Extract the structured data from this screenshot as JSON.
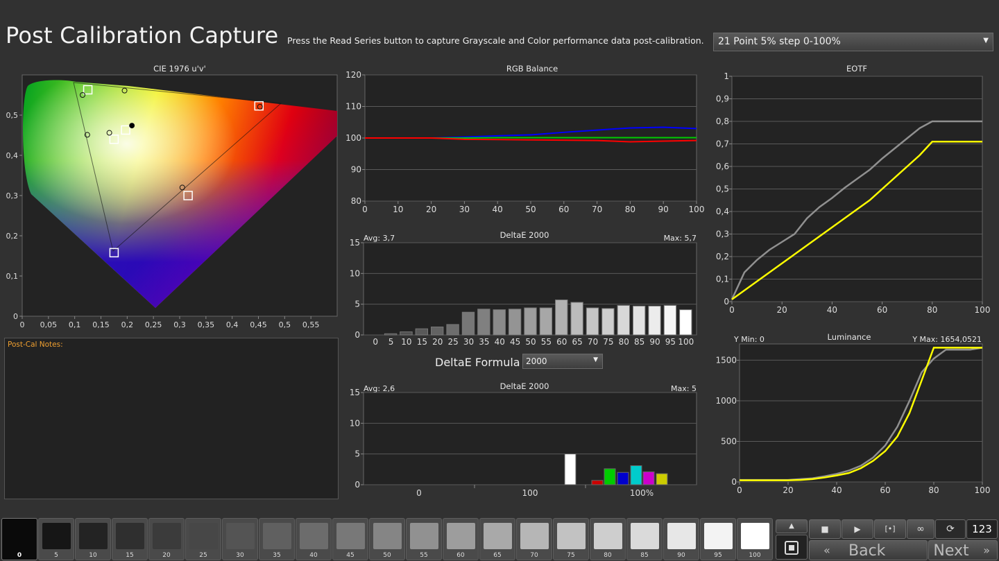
{
  "header": {
    "title": "Post Calibration Capture",
    "instruction": "Press the Read Series button to capture Grayscale and Color performance data post-calibration.",
    "series_option": "21 Point 5% step 0-100%"
  },
  "cie": {
    "title": "CIE 1976 u'v'",
    "x_ticks": [
      "0",
      "0,05",
      "0,1",
      "0,15",
      "0,2",
      "0,25",
      "0,3",
      "0,35",
      "0,4",
      "0,45",
      "0,5",
      "0,55"
    ],
    "y_ticks": [
      "0",
      "0,1",
      "0,2",
      "0,3",
      "0,4",
      "0,5"
    ],
    "targets": [
      [
        0.451,
        0.523
      ],
      [
        0.125,
        0.563
      ],
      [
        0.175,
        0.158
      ],
      [
        0.175,
        0.44
      ],
      [
        0.316,
        0.3
      ],
      [
        0.197,
        0.463
      ]
    ],
    "measured": [
      [
        0.453,
        0.521
      ],
      [
        0.115,
        0.55
      ],
      [
        0.124,
        0.451
      ],
      [
        0.166,
        0.456
      ],
      [
        0.195,
        0.561
      ],
      [
        0.305,
        0.32
      ],
      [
        0.209,
        0.474
      ]
    ]
  },
  "notes": {
    "label": "Post-Cal Notes:",
    "text": ""
  },
  "rgb_balance": {
    "title": "RGB Balance",
    "y_ticks": [
      "80",
      "90",
      "100",
      "110",
      "120"
    ],
    "x_ticks": [
      "0",
      "10",
      "20",
      "30",
      "40",
      "50",
      "60",
      "70",
      "80",
      "90",
      "100"
    ]
  },
  "deltae_gray": {
    "avg": "Avg: 3,7",
    "title": "DeltaE 2000",
    "max": "Max: 5,7",
    "y_ticks": [
      "0",
      "5",
      "10",
      "15"
    ],
    "x_labels": [
      "0",
      "5",
      "10",
      "15",
      "20",
      "25",
      "30",
      "35",
      "40",
      "45",
      "50",
      "55",
      "60",
      "65",
      "70",
      "75",
      "80",
      "85",
      "90",
      "95",
      "100"
    ]
  },
  "formula": {
    "label": "DeltaE Formula",
    "value": "2000"
  },
  "deltae_color": {
    "avg": "Avg: 2,6",
    "title": "DeltaE 2000",
    "max": "Max: 5",
    "y_ticks": [
      "0",
      "5",
      "10",
      "15"
    ],
    "x_labels": [
      "0",
      "100",
      "100%"
    ]
  },
  "eotf": {
    "title": "EOTF",
    "y_ticks": [
      "0",
      "0,1",
      "0,2",
      "0,3",
      "0,4",
      "0,5",
      "0,6",
      "0,7",
      "0,8",
      "0,9",
      "1"
    ],
    "x_ticks": [
      "0",
      "20",
      "40",
      "60",
      "80",
      "100"
    ]
  },
  "luminance": {
    "title": "Luminance",
    "ymin": "Y Min: 0",
    "ymax": "Y Max: 1654,0521",
    "y_ticks": [
      "0",
      "500",
      "1000",
      "1500"
    ],
    "x_ticks": [
      "0",
      "20",
      "40",
      "60",
      "80",
      "100"
    ]
  },
  "swatches": [
    "0",
    "5",
    "10",
    "15",
    "20",
    "25",
    "30",
    "35",
    "40",
    "45",
    "50",
    "55",
    "60",
    "65",
    "70",
    "75",
    "80",
    "85",
    "90",
    "95",
    "100"
  ],
  "controls": {
    "back": "Back",
    "next": "Next",
    "counter": "123"
  },
  "chart_data": [
    {
      "type": "line",
      "title": "RGB Balance",
      "x": [
        0,
        10,
        20,
        30,
        40,
        50,
        60,
        70,
        80,
        90,
        100
      ],
      "ylim": [
        80,
        120
      ],
      "series": [
        {
          "color": "#0000ff",
          "values": [
            100,
            100,
            100,
            100.3,
            100.7,
            101,
            101.8,
            102.5,
            103.2,
            103.4,
            103
          ]
        },
        {
          "color": "#00cc00",
          "values": [
            100,
            100,
            100,
            100,
            100.1,
            100.1,
            100.1,
            100.1,
            100.1,
            100.1,
            100.1
          ]
        },
        {
          "color": "#ff0000",
          "values": [
            100,
            100,
            100,
            99.6,
            99.5,
            99.4,
            99.3,
            99.2,
            98.8,
            99,
            99.2
          ]
        }
      ]
    },
    {
      "type": "bar",
      "title": "DeltaE 2000",
      "categories": [
        "0",
        "5",
        "10",
        "15",
        "20",
        "25",
        "30",
        "35",
        "40",
        "45",
        "50",
        "55",
        "60",
        "65",
        "70",
        "75",
        "80",
        "85",
        "90",
        "95",
        "100"
      ],
      "values": [
        0,
        0.2,
        0.5,
        1,
        1.3,
        1.7,
        3.7,
        4.2,
        4.1,
        4.2,
        4.4,
        4.4,
        5.7,
        5.3,
        4.4,
        4.3,
        4.8,
        4.7,
        4.7,
        4.8,
        4.1
      ],
      "ylim": [
        0,
        15
      ]
    },
    {
      "type": "bar",
      "title": "DeltaE 2000",
      "categories": [
        "W",
        "R",
        "G",
        "B",
        "C",
        "M",
        "Y"
      ],
      "values": [
        5,
        0.7,
        2.6,
        2,
        3.1,
        2.1,
        1.8
      ],
      "colors": [
        "#ffffff",
        "#cc0000",
        "#00cc00",
        "#0000cc",
        "#00cccc",
        "#cc00cc",
        "#cccc00"
      ],
      "ylim": [
        0,
        15
      ]
    },
    {
      "type": "line",
      "title": "EOTF",
      "x": [
        0,
        5,
        10,
        15,
        20,
        25,
        30,
        35,
        40,
        45,
        50,
        55,
        60,
        65,
        70,
        75,
        80,
        85,
        90,
        95,
        100
      ],
      "xlim": [
        0,
        100
      ],
      "ylim": [
        0,
        1
      ],
      "series": [
        {
          "color": "#909090",
          "values": [
            0.01,
            0.13,
            0.185,
            0.23,
            0.265,
            0.3,
            0.37,
            0.42,
            0.46,
            0.505,
            0.545,
            0.585,
            0.635,
            0.68,
            0.725,
            0.77,
            0.8,
            0.8,
            0.8,
            0.8,
            0.8
          ]
        },
        {
          "color": "#ffff00",
          "values": [
            0.01,
            0.05,
            0.09,
            0.13,
            0.17,
            0.21,
            0.25,
            0.29,
            0.33,
            0.37,
            0.41,
            0.45,
            0.5,
            0.55,
            0.6,
            0.65,
            0.71,
            0.71,
            0.71,
            0.71,
            0.71
          ]
        }
      ]
    },
    {
      "type": "line",
      "title": "Luminance",
      "x": [
        0,
        5,
        10,
        15,
        20,
        25,
        30,
        35,
        40,
        45,
        50,
        55,
        60,
        65,
        70,
        75,
        80,
        85,
        90,
        95,
        100
      ],
      "xlim": [
        0,
        100
      ],
      "ylim": [
        0,
        1700
      ],
      "series": [
        {
          "color": "#909090",
          "values": [
            25,
            25,
            25,
            25,
            25,
            35,
            45,
            70,
            100,
            140,
            200,
            300,
            450,
            680,
            1000,
            1350,
            1520,
            1630,
            1630,
            1630,
            1654
          ]
        },
        {
          "color": "#ffff00",
          "values": [
            20,
            20,
            20,
            20,
            20,
            25,
            35,
            55,
            80,
            110,
            170,
            260,
            380,
            560,
            850,
            1250,
            1654,
            1654,
            1654,
            1654,
            1654
          ]
        }
      ]
    }
  ]
}
